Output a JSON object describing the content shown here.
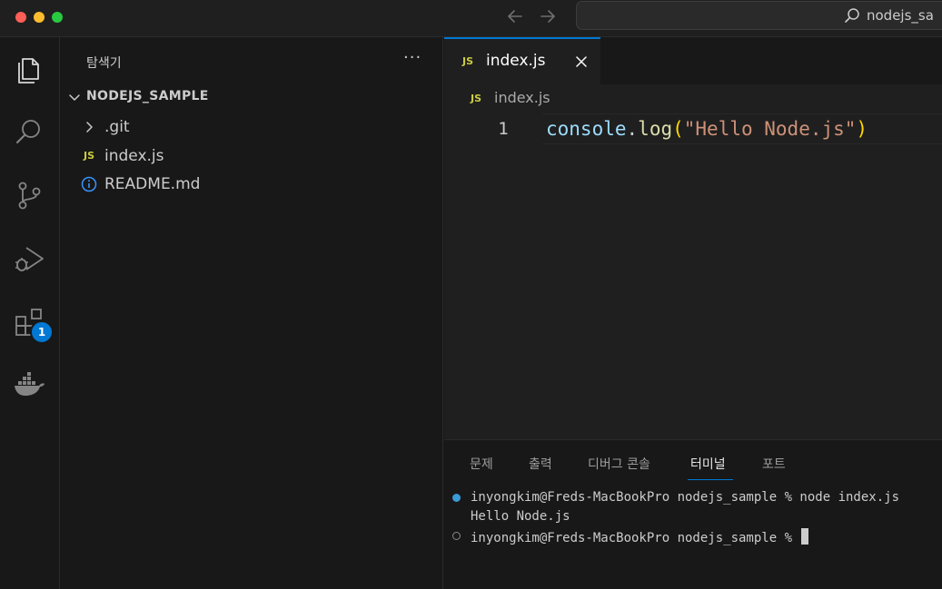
{
  "colors": {
    "accent": "#0078d4",
    "traffic_close": "#ff5f57",
    "traffic_minimize": "#febc2e",
    "traffic_maximize": "#28c840",
    "js_badge": "#cbcb41",
    "info_icon": "#3794ff"
  },
  "titlebar": {
    "command_center_label": "nodejs_sa",
    "icons": [
      "arrow-left-icon",
      "arrow-right-icon",
      "search-icon"
    ]
  },
  "activity_bar": {
    "items": [
      {
        "name": "explorer",
        "icon": "files-icon"
      },
      {
        "name": "search",
        "icon": "search-icon"
      },
      {
        "name": "source-control",
        "icon": "source-control-icon"
      },
      {
        "name": "run-and-debug",
        "icon": "run-debug-icon"
      },
      {
        "name": "extensions",
        "icon": "extensions-icon",
        "badge": "1"
      },
      {
        "name": "docker",
        "icon": "docker-icon"
      }
    ],
    "extensions_badge": "1"
  },
  "sidebar": {
    "title": "탐색기",
    "more_actions": "···",
    "folder": "NODEJS_SAMPLE",
    "items": [
      {
        "label": ".git",
        "icon": "chevron-right-icon"
      },
      {
        "label": "index.js",
        "icon": "js-file-icon",
        "badge": "JS"
      },
      {
        "label": "README.md",
        "icon": "info-icon"
      }
    ]
  },
  "editor": {
    "tab_badge": "JS",
    "tab_label": "index.js",
    "breadcrumb_badge": "JS",
    "breadcrumb_label": "index.js",
    "lines": [
      {
        "number": "1",
        "tokens": {
          "object": "console",
          "dot": ".",
          "method": "log",
          "open_paren": "(",
          "string": "\"Hello Node.js\"",
          "close_paren": ")"
        }
      }
    ]
  },
  "panel": {
    "tabs": [
      "문제",
      "출력",
      "디버그 콘솔",
      "터미널",
      "포트"
    ],
    "active_tab": "터미널",
    "terminal": {
      "prompt_1": "inyongkim@Freds-MacBookPro nodejs_sample % node index.js",
      "output_1": "Hello Node.js",
      "prompt_2": "inyongkim@Freds-MacBookPro nodejs_sample % "
    }
  }
}
